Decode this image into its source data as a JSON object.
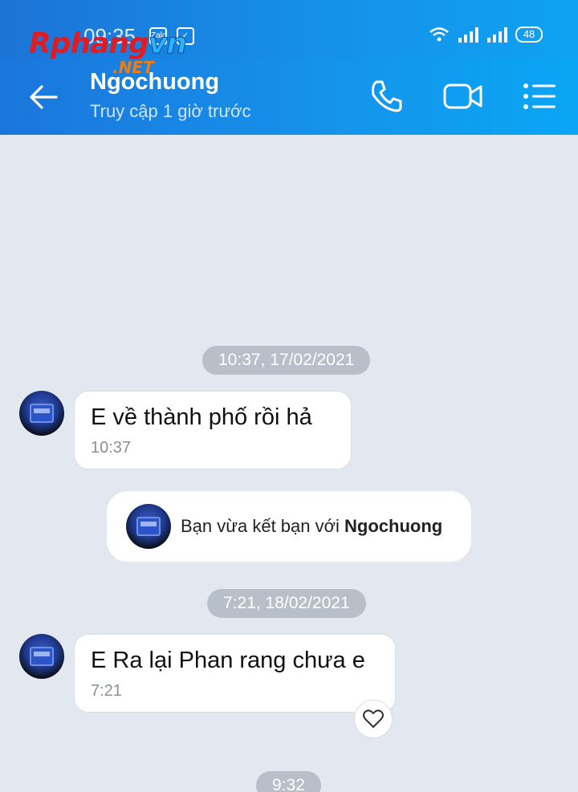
{
  "status_bar": {
    "time": "09:35",
    "app_icons": [
      "Zalo",
      "✓"
    ],
    "battery": "48"
  },
  "watermark": {
    "part1": "Rphang",
    "part2": "vn",
    "suffix": ".NET"
  },
  "header": {
    "contact_name": "Ngochuong",
    "last_seen": "Truy cập 1 giờ trước",
    "icons": [
      "back-arrow-icon",
      "phone-icon",
      "video-call-icon",
      "menu-list-icon"
    ]
  },
  "conversation": {
    "date_1": "10:37, 17/02/2021",
    "message_1": {
      "text": "E về thành phố rồi hả",
      "time": "10:37"
    },
    "friend_notice": {
      "prefix": "Bạn vừa kết bạn với ",
      "name": "Ngochuong"
    },
    "date_2": "7:21, 18/02/2021",
    "message_2": {
      "text": "E Ra lại Phan rang chưa e",
      "time": "7:21"
    },
    "date_3": "9:32"
  },
  "colors": {
    "header_gradient_start": "#1b76dc",
    "header_gradient_end": "#0aa6f5",
    "chat_background": "#e3e8f0",
    "date_pill": "#b9bfc8"
  }
}
